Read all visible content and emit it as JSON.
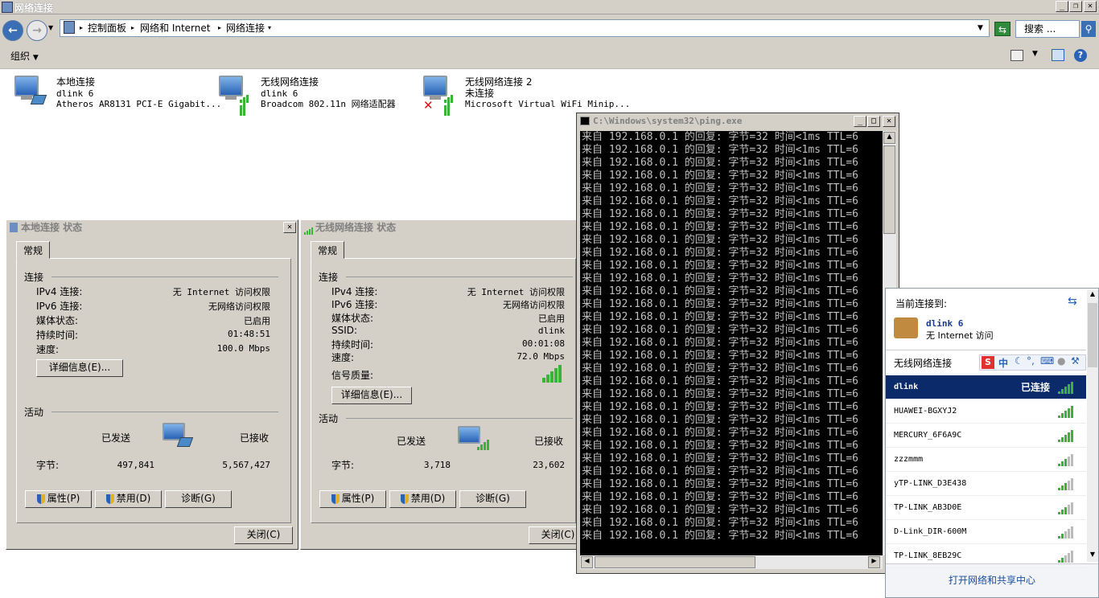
{
  "window": {
    "title": "网络连接",
    "min": "_",
    "max": "❐",
    "close": "✕"
  },
  "address": {
    "path": [
      "控制面板",
      "网络和 Internet",
      "网络连接"
    ],
    "search_placeholder": "搜索 ..."
  },
  "toolbar": {
    "organize": "组织"
  },
  "connections": [
    {
      "name": "本地连接",
      "network": "dlink  6",
      "adapter": "Atheros AR8131 PCI-E Gigabit..."
    },
    {
      "name": "无线网络连接",
      "network": "dlink  6",
      "adapter": "Broadcom 802.11n 网络适配器"
    },
    {
      "name": "无线网络连接 2",
      "network": "未连接",
      "adapter": "Microsoft Virtual WiFi Minip..."
    }
  ],
  "local_status": {
    "title": "本地连接 状态",
    "tab": "常规",
    "conn_header": "连接",
    "rows": [
      {
        "label": "IPv4 连接:",
        "value": "无 Internet 访问权限"
      },
      {
        "label": "IPv6 连接:",
        "value": "无网络访问权限"
      },
      {
        "label": "媒体状态:",
        "value": "已启用"
      },
      {
        "label": "持续时间:",
        "value": "01:48:51"
      },
      {
        "label": "速度:",
        "value": "100.0 Mbps"
      }
    ],
    "details_btn": "详细信息(E)...",
    "activity_header": "活动",
    "sent_label": "已发送",
    "recv_label": "已接收",
    "bytes_label": "字节:",
    "sent": "497,841",
    "recv": "5,567,427",
    "props_btn": "属性(P)",
    "disable_btn": "禁用(D)",
    "diagnose_btn": "诊断(G)",
    "close_btn": "关闭(C)"
  },
  "wireless_status": {
    "title": "无线网络连接 状态",
    "tab": "常规",
    "conn_header": "连接",
    "rows": [
      {
        "label": "IPv4 连接:",
        "value": "无 Internet 访问权限"
      },
      {
        "label": "IPv6 连接:",
        "value": "无网络访问权限"
      },
      {
        "label": "媒体状态:",
        "value": "已启用"
      },
      {
        "label": "SSID:",
        "value": "dlink"
      },
      {
        "label": "持续时间:",
        "value": "00:01:08"
      },
      {
        "label": "速度:",
        "value": "72.0 Mbps"
      }
    ],
    "signal_label": "信号质量:",
    "signal_level": 5,
    "details_btn": "详细信息(E)...",
    "activity_header": "活动",
    "sent_label": "已发送",
    "recv_label": "已接收",
    "bytes_label": "字节:",
    "sent": "3,718",
    "recv": "23,602",
    "props_btn": "属性(P)",
    "disable_btn": "禁用(D)",
    "diagnose_btn": "诊断(G)",
    "close_btn": "关闭(C)"
  },
  "cmd": {
    "title": "C:\\Windows\\system32\\ping.exe",
    "line": "来自 192.168.0.1 的回复: 字节=32 时间<1ms TTL=6",
    "line_count": 32
  },
  "wifi_panel": {
    "current_label": "当前连接到:",
    "current_network": "dlink  6",
    "current_status": "无 Internet 访问",
    "section_label": "无线网络连接",
    "ime": "中",
    "networks": [
      {
        "name": "dlink",
        "status": "已连接",
        "signal": 5
      },
      {
        "name": "HUAWEI-BGXYJ2",
        "signal": 5
      },
      {
        "name": "MERCURY_6F6A9C",
        "signal": 5
      },
      {
        "name": "zzzmmm",
        "signal": 3
      },
      {
        "name": "yTP-LINK_D3E438",
        "signal": 3
      },
      {
        "name": "TP-LINK_AB3D0E",
        "signal": 3
      },
      {
        "name": "D-Link_DIR-600M",
        "signal": 2
      },
      {
        "name": "TP-LINK_8EB29C",
        "signal": 2
      }
    ],
    "footer_link": "打开网络和共享中心"
  }
}
